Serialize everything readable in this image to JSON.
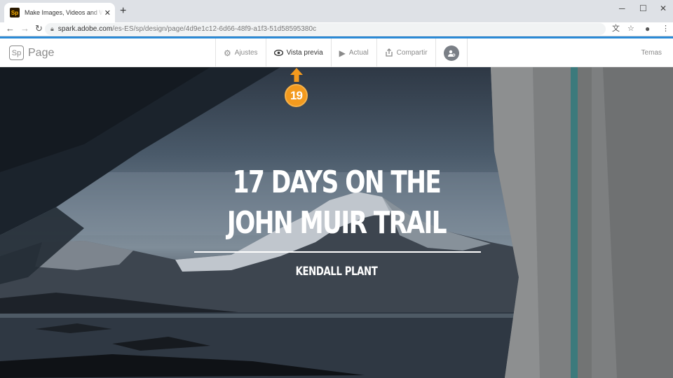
{
  "browser": {
    "tab_title": "Make Images, Videos and Web S",
    "favicon_label": "Sp",
    "new_tab": "+",
    "close_tab": "✕",
    "url_host": "spark.adobe.com",
    "url_path": "/es-ES/sp/design/page/4d9e1c12-6d66-48f9-a1f3-51d58595380c",
    "icons": [
      "back-icon",
      "forward-icon",
      "reload-icon",
      "lock-icon",
      "translate-icon",
      "star-icon",
      "account-icon",
      "menu-icon",
      "minimize-icon",
      "maximize-icon",
      "close-icon"
    ]
  },
  "header": {
    "brand_badge": "Sp",
    "brand_name": "Page",
    "menu": [
      {
        "label": "Ajustes",
        "icon": "gear-icon"
      },
      {
        "label": "Vista previa",
        "icon": "eye-icon"
      },
      {
        "label": "Actual",
        "icon": "play-icon"
      },
      {
        "label": "Compartir",
        "icon": "share-icon"
      }
    ],
    "collab_icon": "invite-collaborator-icon",
    "themes_label": "Temas"
  },
  "hero": {
    "title": "17 DAYS ON THE JOHN MUIR TRAIL",
    "author": "KENDALL PLANT"
  },
  "annotation": {
    "step_number": "19",
    "color": "#f39a1e"
  },
  "colors": {
    "accent_blue": "#2b8ad6",
    "muted_text": "#8a8a8a"
  }
}
